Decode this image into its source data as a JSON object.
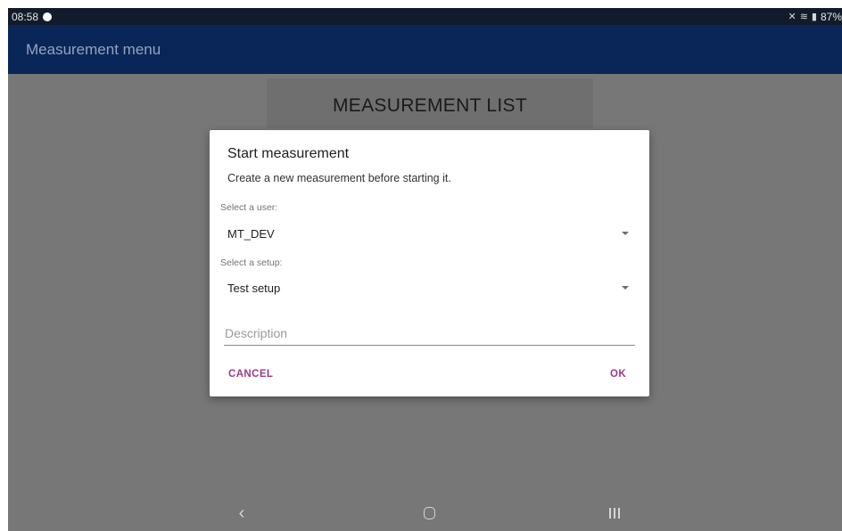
{
  "status_bar": {
    "time": "08:58",
    "battery": "87%"
  },
  "app_bar": {
    "title": "Measurement menu"
  },
  "content": {
    "list_header": "MEASUREMENT LIST"
  },
  "dialog": {
    "title": "Start measurement",
    "message": "Create a new measurement before starting it.",
    "user_label": "Select a user:",
    "user_value": "MT_DEV",
    "setup_label": "Select a setup:",
    "setup_value": "Test setup",
    "description_placeholder": "Description",
    "cancel_label": "CANCEL",
    "ok_label": "OK"
  },
  "nav_bar": {
    "icons": [
      "back-icon",
      "home-icon",
      "recents-icon"
    ]
  }
}
